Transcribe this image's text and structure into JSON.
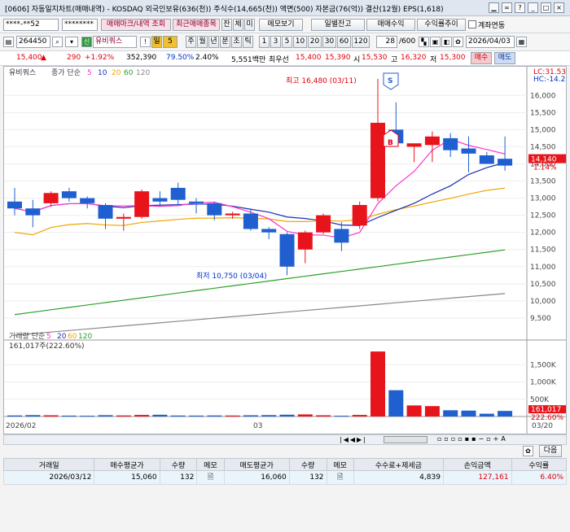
{
  "window": {
    "title": "[0606] 자동일지차트(매매내역) - KOSDAQ 외국인보유(636(천)) 주식수(14,665(천)) 액면(500) 자본금(76(억)) 결산(12월) EPS(1,618)"
  },
  "toolbar1": {
    "account": "****-**52",
    "password": "********",
    "btn_mark": "매매마크/내역 조회",
    "btn_recent": "최근매매종목",
    "btn_jan": "잔",
    "btn_che": "체",
    "btn_mi": "미",
    "btn_memo": "메모보기",
    "btn_daily": "일별잔고",
    "btn_profit": "매매수익",
    "btn_trend": "수익률추이",
    "chk_account": "계좌연동"
  },
  "toolbar2": {
    "code": "264450",
    "stock_name": "유비쿼스",
    "badge_sin": "신",
    "period_labels": [
      "일",
      "5",
      "주",
      "월",
      "년",
      "분",
      "초",
      "틱"
    ],
    "intervals": [
      "1",
      "3",
      "5",
      "10",
      "20",
      "30",
      "60",
      "120"
    ],
    "count": "28",
    "count_total": "/600",
    "date": "2026/04/03"
  },
  "quote": {
    "price": "15,400",
    "arrow": "▲",
    "change": "290",
    "change_pct": "+1.92%",
    "volume": "352,390",
    "vol_ratio": "79.50%",
    "turnover": "2.40%",
    "amount": "5,551백만",
    "label_bid": "최우선",
    "bid": "15,400",
    "ask": "15,390",
    "label_open": "시",
    "open": "15,530",
    "label_high": "고",
    "high": "16,320",
    "label_low": "저",
    "low": "15,300",
    "btn_buy": "매수",
    "btn_sell": "매도"
  },
  "chart": {
    "legend_name": "유비쿼스",
    "legend_ma": "종가 단순",
    "legend_periods": [
      "5",
      "10",
      "20",
      "60",
      "120"
    ],
    "lc": "LC:31.53",
    "hc": "HC:-14.20",
    "high_note": "최고 16,480 (03/11)",
    "low_note": "최저 10,750 (03/04)",
    "last_price": "14,140",
    "last_pct": "1.14%",
    "y_ticks": [
      "16,000",
      "15,500",
      "15,000",
      "14,500",
      "14,000",
      "13,500",
      "13,000",
      "12,500",
      "12,000",
      "11,500",
      "11,000",
      "10,500",
      "10,000",
      "9,500"
    ],
    "vol_legend": "거래량 단순",
    "vol_periods": [
      "5",
      "20",
      "60",
      "120"
    ],
    "vol_info": "161,017주(222.60%)",
    "vol_ticks": [
      "1,500K",
      "1,000K",
      "500K"
    ],
    "vol_last": "161,017",
    "vol_last_pct": "222.60%",
    "x_labels": [
      "2026/02",
      "03",
      "03/20"
    ],
    "marker_s": "S",
    "marker_b": "B"
  },
  "colors": {
    "up": "#e8141b",
    "down": "#1f5fd0",
    "ma5": "#ff33cc",
    "ma10": "#1a2fb0",
    "ma20": "#f0a500",
    "ma60": "#2aa02a",
    "ma120": "#888888"
  },
  "chart_data": {
    "type": "candlestick",
    "candles": [
      [
        12.9,
        13.3,
        12.5,
        12.7
      ],
      [
        12.7,
        12.95,
        12.15,
        12.5
      ],
      [
        12.85,
        13.2,
        12.75,
        13.15
      ],
      [
        13.2,
        13.3,
        12.9,
        13.0
      ],
      [
        13.0,
        13.05,
        12.7,
        12.85
      ],
      [
        12.8,
        12.85,
        12.1,
        12.4
      ],
      [
        12.4,
        12.55,
        12.05,
        12.45
      ],
      [
        12.45,
        13.25,
        12.4,
        13.2
      ],
      [
        13.0,
        13.2,
        12.75,
        12.9
      ],
      [
        13.3,
        13.45,
        12.8,
        12.95
      ],
      [
        12.9,
        13.0,
        12.55,
        12.85
      ],
      [
        12.85,
        12.9,
        12.35,
        12.5
      ],
      [
        12.5,
        12.6,
        12.4,
        12.55
      ],
      [
        12.55,
        12.7,
        12.05,
        12.1
      ],
      [
        12.1,
        12.15,
        11.8,
        12.0
      ],
      [
        11.95,
        12.0,
        10.75,
        11.0
      ],
      [
        11.5,
        12.05,
        11.1,
        12.0
      ],
      [
        12.0,
        12.55,
        11.95,
        12.5
      ],
      [
        12.1,
        12.3,
        11.45,
        11.7
      ],
      [
        12.2,
        12.9,
        12.1,
        12.8
      ],
      [
        13.0,
        16.48,
        12.9,
        15.2
      ],
      [
        15.0,
        15.8,
        14.55,
        14.6
      ],
      [
        14.5,
        14.6,
        14.05,
        14.6
      ],
      [
        14.55,
        14.95,
        14.05,
        14.8
      ],
      [
        14.75,
        14.9,
        14.2,
        14.4
      ],
      [
        14.45,
        14.8,
        13.75,
        14.3
      ],
      [
        14.25,
        14.35,
        14.0,
        14.0
      ],
      [
        14.15,
        14.8,
        13.8,
        13.95
      ]
    ],
    "volumes": [
      30,
      40,
      35,
      25,
      22,
      38,
      30,
      45,
      50,
      28,
      26,
      30,
      28,
      35,
      40,
      52,
      60,
      35,
      22,
      45,
      1880,
      760,
      320,
      300,
      180,
      170,
      80,
      161
    ],
    "units": "price in thousands KRW, volume in thousands of shares"
  }
}
